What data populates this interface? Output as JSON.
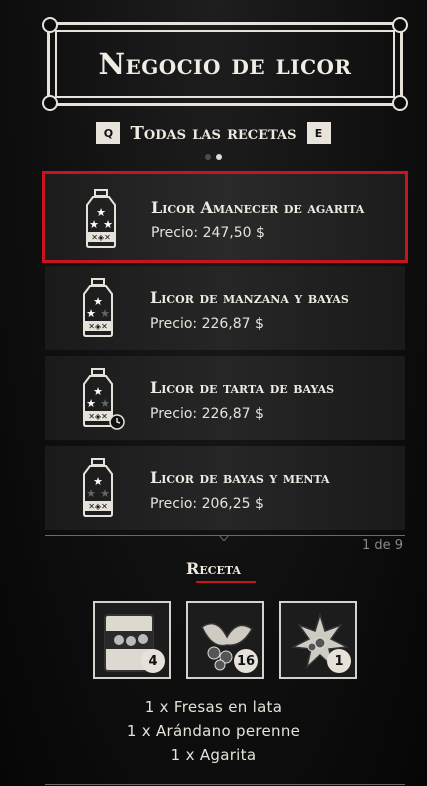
{
  "header": {
    "title": "Negocio de licor"
  },
  "filter": {
    "prev_key": "Q",
    "label": "Todas las recetas",
    "next_key": "E"
  },
  "pager_dots": 2,
  "items": [
    {
      "name": "Licor Amanecer de agarita",
      "price": "Precio: 247,50 $",
      "stars": 3,
      "timer": false,
      "selected": true
    },
    {
      "name": "Licor de manzana y bayas",
      "price": "Precio: 226,87 $",
      "stars": 2,
      "timer": false,
      "selected": false
    },
    {
      "name": "Licor de tarta de bayas",
      "price": "Precio: 226,87 $",
      "stars": 2,
      "timer": true,
      "selected": false
    },
    {
      "name": "Licor de bayas y menta",
      "price": "Precio: 206,25 $",
      "stars": 1,
      "timer": false,
      "selected": false
    }
  ],
  "page_count": "1 de 9",
  "recipe": {
    "title": "Receta",
    "ingredients": [
      {
        "icon": "canned-strawberries-icon",
        "count": "4"
      },
      {
        "icon": "evergreen-huckleberry-icon",
        "count": "16"
      },
      {
        "icon": "agarita-icon",
        "count": "1"
      }
    ],
    "requirements": [
      "1 x Fresas en lata",
      "1 x Arándano perenne",
      "1 x Agarita"
    ]
  },
  "colors": {
    "accent_red": "#c9131e",
    "text": "#e8e4dc",
    "background": "#0b0b0b"
  }
}
